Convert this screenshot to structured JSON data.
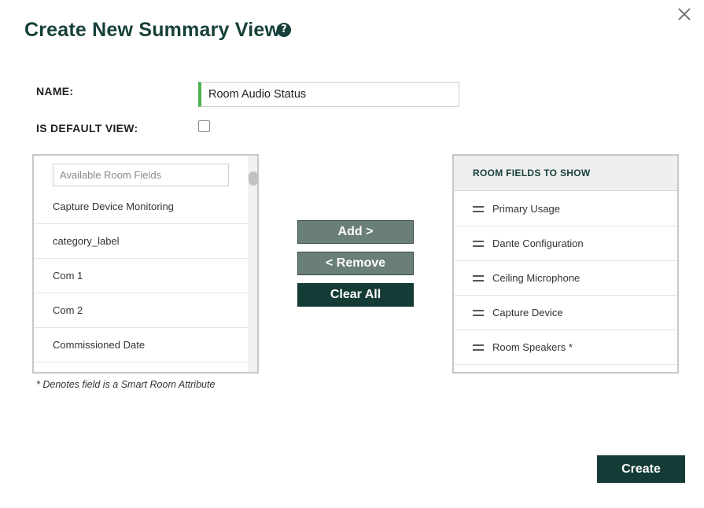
{
  "dialog": {
    "title": "Create New Summary View",
    "help_icon": "question-circle-icon",
    "close_icon": "close-icon"
  },
  "form": {
    "name_label": "NAME:",
    "name_value": "Room Audio Status",
    "default_label": "IS DEFAULT VIEW:",
    "default_checked": false
  },
  "available": {
    "search_placeholder": "Available Room Fields",
    "items": [
      {
        "label": "Capture Device Monitoring"
      },
      {
        "label": "category_label"
      },
      {
        "label": "Com 1"
      },
      {
        "label": "Com 2"
      },
      {
        "label": "Commissioned Date"
      }
    ]
  },
  "buttons": {
    "add": "Add >",
    "remove": "< Remove",
    "clear_all": "Clear All",
    "create": "Create"
  },
  "to_show": {
    "header": "ROOM FIELDS TO SHOW",
    "drag_icon": "drag-handle-icon",
    "items": [
      {
        "label": "Primary Usage"
      },
      {
        "label": "Dante Configuration"
      },
      {
        "label": "Ceiling Microphone"
      },
      {
        "label": "Capture Device"
      },
      {
        "label": "Room Speakers *"
      }
    ]
  },
  "footnote": "* Denotes field is a Smart Room Attribute",
  "colors": {
    "brand_dark": "#143b35",
    "button_muted": "#6a7e7a",
    "input_accent": "#4caf50"
  }
}
